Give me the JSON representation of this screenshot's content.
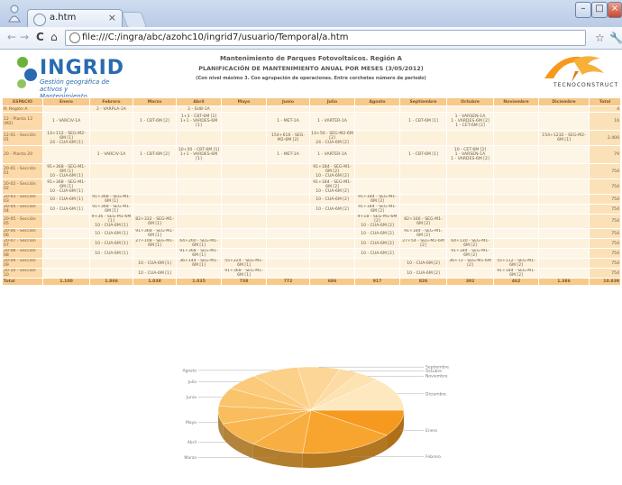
{
  "browser": {
    "tab_title": "a.htm",
    "url": "file:///C:/ingra/abc/azohc10/ingrid7/usuario/Temporal/a.htm"
  },
  "header": {
    "logo_text": "INGRID",
    "logo_subtitle_1": "Gestión geográfica de",
    "logo_subtitle_2": "activos y Mantenimiento",
    "title": "Mantenimiento de Parques Fotovoltaicos. Región A",
    "subtitle": "PLANIFICACIÓN DE MANTENIMIENTO ANUAL POR MESES (3/05/2012)",
    "note": "(Con nivel máximo 3. Con agrupación de operaciones. Entre corchetes número de periodo)",
    "right_logo_text": "TECNOCONSTRUCT"
  },
  "table": {
    "columns": [
      "ESPACIO",
      "Enero",
      "Febrero",
      "Marzo",
      "Abril",
      "Mayo",
      "Junio",
      "Julio",
      "Agosto",
      "Septiembre",
      "Octubre",
      "Noviembre",
      "Diciembre",
      "Total"
    ],
    "rows": [
      [
        "R: Región A",
        "",
        "2 - VARPLA-1A",
        "",
        "2 - SUB-1A",
        "",
        "",
        "",
        "",
        "",
        "",
        "",
        "",
        "4"
      ],
      [
        "12 - Planta 12 (M2)",
        "1 - VARCIV-1A",
        "",
        "1 - CBT-6M [2]",
        "1+3 - CBT-6M [1]\n1+1 - VARDES-6M [1]",
        "",
        "1 - MET-1A",
        "1 - VARTER-1A",
        "",
        "1 - CBT-6M [1]",
        "1 - VARSEN-1A\n1 - VARDES-6M [2]\n1 - CET-6M [2]",
        "",
        "",
        "16"
      ],
      [
        "12-01 - Sección 01",
        "14+112 - SEG-M2-6M [1]\n24 - CUA-6M [1]",
        "",
        "",
        "",
        "",
        "154+616 - SEG-M2-6M [2]",
        "14+56 - SEG-M2-6M [2]\n24 - CUA-6M [2]",
        "",
        "",
        "",
        "",
        "154+1232 - SEG-M2-6M [1]",
        "2.400"
      ],
      [
        "20 - Planta 20",
        "",
        "1 - VARCIV-1A",
        "1 - CBT-6M [2]",
        "10+50 - CBT-6M [1]\n1+1 - VARDES-6M [1]",
        "",
        "1 - MET-1A",
        "1 - VARTER-1A",
        "",
        "1 - CBT-6M [1]",
        "10 - CET-6M [2]\n1 - VARSEN-1A\n1 - VARDES-6M [2]",
        "",
        "",
        "79"
      ],
      [
        "20-01 - Sección 01",
        "91+368 - SEG-M1-6M [1]\n10 - CUA-6M [1]",
        "",
        "",
        "",
        "",
        "",
        "91+184 - SEG-M1-6M [2]\n10 - CUA-6M [2]",
        "",
        "",
        "",
        "",
        "",
        "754"
      ],
      [
        "20-02 - Sección 02",
        "91+368 - SEG-M1-6M [1]\n10 - CUA-6M [1]",
        "",
        "",
        "",
        "",
        "",
        "91+184 - SEG-M1-6M [2]\n10 - CUA-6M [2]",
        "",
        "",
        "",
        "",
        "",
        "754"
      ],
      [
        "20-03 - Sección 03",
        "10 - CUA-6M [1]",
        "91+368 - SEG-M1-6M [1]",
        "",
        "",
        "",
        "",
        "10 - CUA-6M [2]",
        "91+184 - SEG-M1-6M [2]",
        "",
        "",
        "",
        "",
        "754"
      ],
      [
        "20-04 - Sección 04",
        "10 - CUA-6M [1]",
        "91+368 - SEG-M1-6M [1]",
        "",
        "",
        "",
        "",
        "10 - CUA-6M [2]",
        "91+184 - SEG-M1-6M [2]",
        "",
        "",
        "",
        "",
        "754"
      ],
      [
        "20-05 - Sección 05",
        "",
        "9+36 - SEG-M1-6M [1]\n10 - CUA-6M [1]",
        "82+332 - SEG-M1-6M [1]",
        "",
        "",
        "",
        "",
        "9+18 - SEG-M1-6M [2]\n10 - CUA-6M [2]",
        "82+166 - SEG-M1-6M [2]",
        "",
        "",
        "",
        "754"
      ],
      [
        "20-06 - Sección 06",
        "",
        "10 - CUA-6M [1]",
        "91+368 - SEG-M1-6M [1]",
        "",
        "",
        "",
        "",
        "10 - CUA-6M [2]",
        "91+184 - SEG-M1-6M [2]",
        "",
        "",
        "",
        "754"
      ],
      [
        "20-07 - Sección 07",
        "",
        "10 - CUA-6M [1]",
        "27+108 - SEG-M1-6M [1]",
        "64+260 - SEG-M1-6M [1]",
        "",
        "",
        "",
        "10 - CUA-6M [2]",
        "27+54 - SEG-M1-6M [2]",
        "64+130 - SEG-M1-6M [2]",
        "",
        "",
        "754"
      ],
      [
        "20-08 - Sección 08",
        "",
        "10 - CUA-6M [1]",
        "",
        "91+368 - SEG-M1-6M [1]",
        "",
        "",
        "",
        "10 - CUA-6M [2]",
        "",
        "91+184 - SEG-M1-6M [2]",
        "",
        "",
        "754"
      ],
      [
        "20-09 - Sección 09",
        "",
        "",
        "10 - CUA-6M [1]",
        "36+144 - SEG-M1-6M [1]",
        "55+224 - SEG-M1-6M [1]",
        "",
        "",
        "",
        "10 - CUA-6M [2]",
        "36+72 - SEG-M1-6M [2]",
        "55+112 - SEG-M1-6M [2]",
        "",
        "754"
      ],
      [
        "20-10 - Sección 10",
        "",
        "",
        "10 - CUA-6M [1]",
        "",
        "91+368 - SEG-M1-6M [1]",
        "",
        "",
        "",
        "10 - CUA-6M [2]",
        "",
        "91+184 - SEG-M1-6M [2]",
        "",
        "754"
      ]
    ],
    "total_row": [
      "Total",
      "1.100",
      "1.866",
      "1.038",
      "1.035",
      "738",
      "772",
      "686",
      "917",
      "826",
      "392",
      "462",
      "1.386",
      "10.839"
    ]
  },
  "pie": {
    "labels": [
      "Enero",
      "Febrero",
      "Marzo",
      "Abril",
      "Mayo",
      "Junio",
      "Julio",
      "Agosto",
      "Septiembre",
      "Octubre",
      "Noviembre",
      "Diciembre"
    ],
    "values": [
      1100,
      1866,
      1038,
      1035,
      738,
      772,
      686,
      917,
      826,
      392,
      462,
      1386
    ],
    "colors": [
      "#f59a1e",
      "#f7a52e",
      "#f8ae40",
      "#f9b64f",
      "#f9bd5e",
      "#fac46c",
      "#fbca7a",
      "#fbd088",
      "#fcd696",
      "#fcdca4",
      "#fde2b2",
      "#fde8c0"
    ]
  },
  "colors": {
    "header_orange": "#f7c98a",
    "row_light": "#fdf1dc",
    "space_cell": "#fbd9a8"
  }
}
